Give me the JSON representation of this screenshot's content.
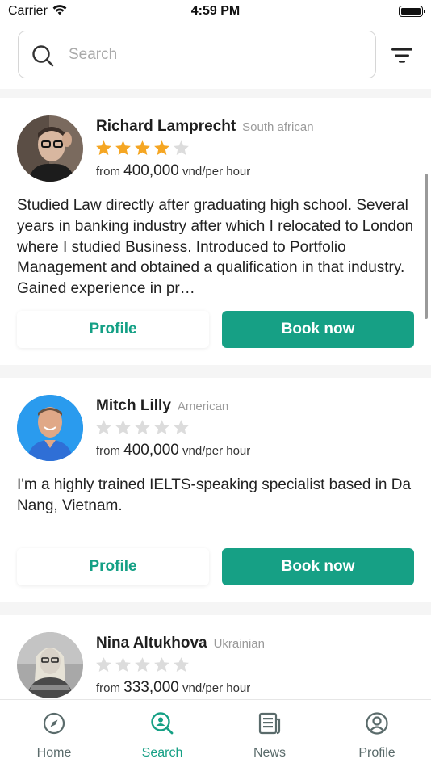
{
  "status_bar": {
    "carrier": "Carrier",
    "time": "4:59 PM"
  },
  "search": {
    "placeholder": "Search",
    "value": ""
  },
  "tutors": [
    {
      "name": "Richard Lamprecht",
      "nationality": "South african",
      "rating": 4,
      "price_prefix": "from",
      "price": "400,000",
      "price_unit": "vnd/per hour",
      "bio": "Studied Law directly after graduating high school. Several years in banking industry after which I relocated to London where I studied Business. Introduced to Portfolio Management and obtained a qualification in that industry. Gained experience in pr…",
      "profile_label": "Profile",
      "book_label": "Book now"
    },
    {
      "name": "Mitch Lilly",
      "nationality": "American",
      "rating": 0,
      "price_prefix": "from",
      "price": "400,000",
      "price_unit": "vnd/per hour",
      "bio": "I'm a highly trained IELTS-speaking specialist based in Da Nang, Vietnam.",
      "profile_label": "Profile",
      "book_label": "Book now"
    },
    {
      "name": "Nina Altukhova",
      "nationality": "Ukrainian",
      "rating": 0,
      "price_prefix": "from",
      "price": "333,000",
      "price_unit": "vnd/per hour"
    }
  ],
  "tabbar": {
    "items": [
      {
        "label": "Home",
        "icon": "compass-icon",
        "active": false
      },
      {
        "label": "Search",
        "icon": "search-person-icon",
        "active": true
      },
      {
        "label": "News",
        "icon": "newspaper-icon",
        "active": false
      },
      {
        "label": "Profile",
        "icon": "user-circle-icon",
        "active": false
      }
    ]
  },
  "colors": {
    "accent": "#16a085",
    "star_filled": "#f5a623",
    "star_empty": "#dcdcdc"
  }
}
